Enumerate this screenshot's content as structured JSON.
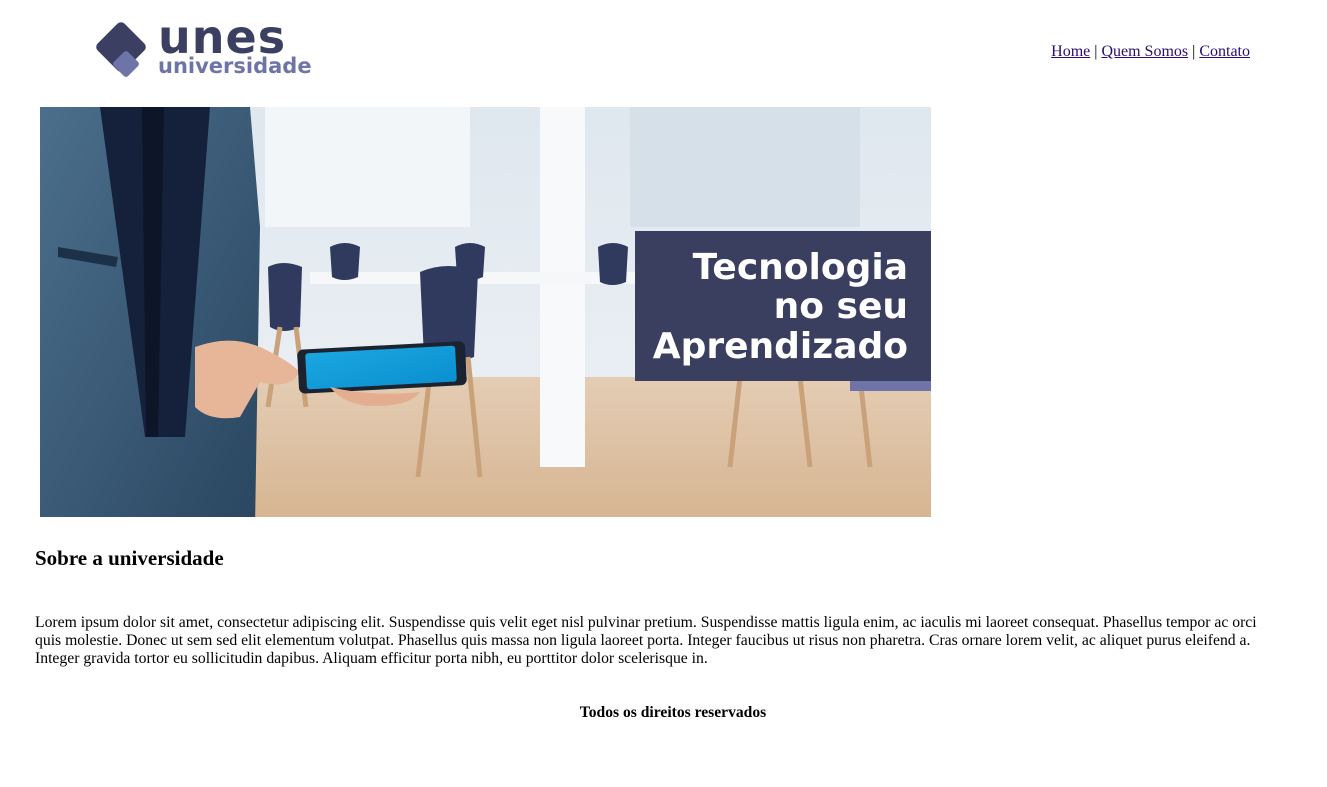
{
  "logo": {
    "primary": "unes",
    "secondary": "universidade"
  },
  "nav": {
    "items": [
      "Home",
      "Quem Somos",
      "Contato"
    ],
    "separator": "|"
  },
  "banner": {
    "lines": [
      "Tecnologia",
      "no seu",
      "Aprendizado"
    ]
  },
  "section": {
    "title": "Sobre a universidade",
    "body": "Lorem ipsum dolor sit amet, consectetur adipiscing elit. Suspendisse quis velit eget nisl pulvinar pretium. Suspendisse mattis ligula enim, ac iaculis mi laoreet consequat. Phasellus tempor ac orci quis molestie. Donec ut sem sed elit elementum volutpat. Phasellus quis massa non ligula laoreet porta. Integer faucibus ut risus non pharetra. Cras ornare lorem velit, ac aliquet purus eleifend a. Integer gravida tortor eu sollicitudin dapibus. Aliquam efficitur porta nibh, eu porttitor dolor scelerisque in."
  },
  "footer": {
    "text": "Todos os direitos reservados"
  },
  "colors": {
    "brand_dark": "#3b3f62",
    "brand_light": "#6f74a8",
    "link": "#2d0b70",
    "banner_box": "#3a3e5f"
  }
}
